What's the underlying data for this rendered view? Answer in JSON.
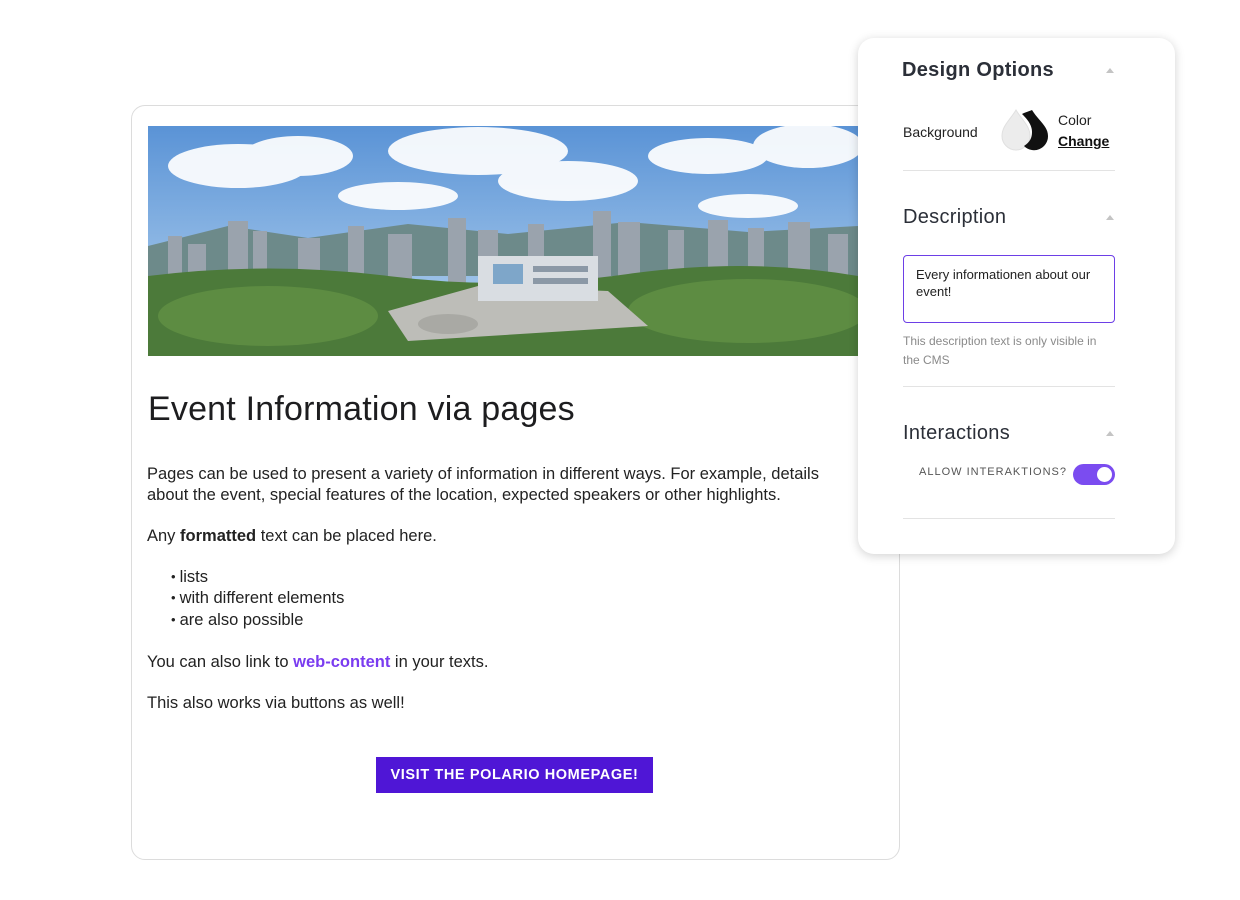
{
  "page": {
    "title": "Event Information via pages",
    "paragraph1": "Pages can be used to present a variety of information in different ways. For example, details",
    "paragraph1_cont": " about the event, special features of the location, expected speakers or other highlights.",
    "formatted_prefix": "Any ",
    "formatted_bold": "formatted",
    "formatted_suffix": " text can be placed here.",
    "list_items": [
      "lists",
      "with different elements",
      "are also possible"
    ],
    "link_prefix": "You can also link to ",
    "link_text": "web-content",
    "link_suffix": " in your texts.",
    "buttons_text": "This also works via buttons as well!",
    "cta_label": "VISIT THE POLARIO HOMEPAGE!"
  },
  "panel": {
    "design_options": {
      "title": "Design Options",
      "background_label": "Background",
      "color_label": "Color",
      "change_label": "Change"
    },
    "description": {
      "title": "Description",
      "value": "Every informationen about our event!",
      "hint": "This description text is only visible in the CMS"
    },
    "interactions": {
      "title": "Interactions",
      "toggle_label": "ALLOW INTERAKTIONS?",
      "toggle_on": true
    }
  },
  "colors": {
    "accent": "#4f16d6",
    "link": "#7a3cf0",
    "toggle": "#7b4cf0",
    "input_border": "#6d3fe6"
  },
  "icons": [
    "drop-light-icon",
    "drop-dark-icon",
    "caret-up-icon"
  ]
}
